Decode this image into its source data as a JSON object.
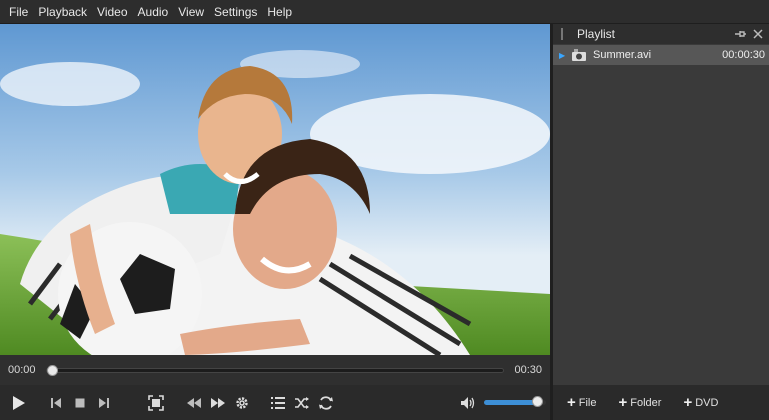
{
  "menu": [
    "File",
    "Playback",
    "Video",
    "Audio",
    "View",
    "Settings",
    "Help"
  ],
  "player": {
    "current_time": "00:00",
    "total_time": "00:30",
    "progress": 0.0,
    "volume": 0.85
  },
  "controls": {
    "icons": [
      "play-icon",
      "previous-icon",
      "stop-icon",
      "next-icon",
      "fullscreen-icon",
      "rewind-icon",
      "fast-forward-icon",
      "settings-icon",
      "playlist-icon",
      "shuffle-icon",
      "repeat-icon",
      "volume-icon"
    ]
  },
  "playlist": {
    "title": "Playlist",
    "items": [
      {
        "name": "Summer.avi",
        "duration": "00:00:30",
        "playing": true
      }
    ],
    "footer": {
      "add_file": "File",
      "add_folder": "Folder",
      "add_dvd": "DVD"
    }
  },
  "colors": {
    "accent": "#3d8fd6",
    "playing_arrow": "#39a6ff"
  }
}
